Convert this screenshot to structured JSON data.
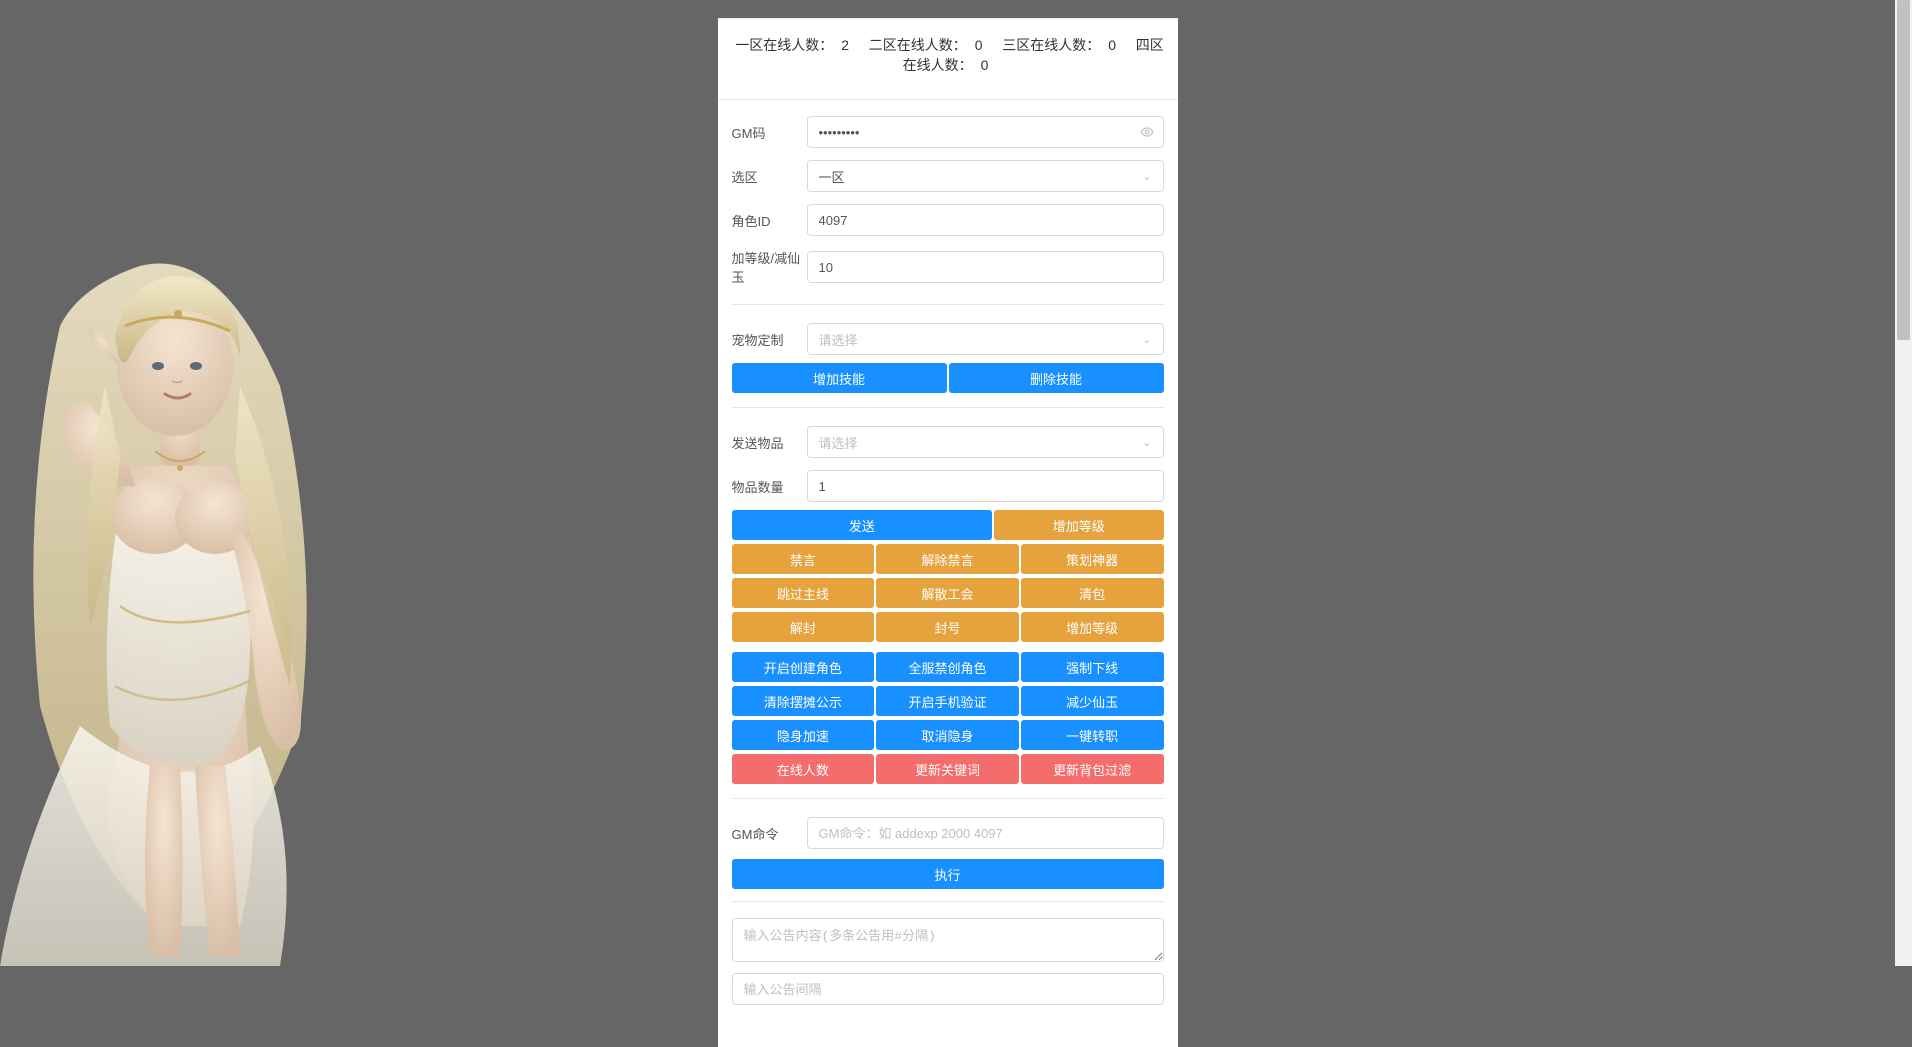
{
  "header": {
    "zone1_label": "一区在线人数：",
    "zone1_count": "2",
    "zone2_label": "二区在线人数：",
    "zone2_count": "0",
    "zone3_label": "三区在线人数：",
    "zone3_count": "0",
    "zone4_label": "四区在线人数：",
    "zone4_count": "0"
  },
  "form": {
    "gm_code_label": "GM码",
    "gm_code_value": "•••••••••",
    "zone_label": "选区",
    "zone_value": "一区",
    "role_id_label": "角色ID",
    "role_id_value": "4097",
    "level_label": "加等级/减仙玉",
    "level_value": "10",
    "pet_label": "宠物定制",
    "pet_placeholder": "请选择",
    "send_item_label": "发送物品",
    "send_item_placeholder": "请选择",
    "item_qty_label": "物品数量",
    "item_qty_value": "1",
    "gm_cmd_label": "GM命令",
    "gm_cmd_placeholder": "GM命令：如 addexp 2000 4097",
    "announce_placeholder": "输入公告内容(多条公告用#分隔)",
    "announce_interval_placeholder": "输入公告间隔"
  },
  "buttons": {
    "add_skill": "增加技能",
    "del_skill": "删除技能",
    "send": "发送",
    "add_level": "增加等级",
    "mute": "禁言",
    "unmute": "解除禁言",
    "plan_weapon": "策划神器",
    "skip_main": "跳过主线",
    "disband_guild": "解散工会",
    "clear_bag": "清包",
    "unban": "解封",
    "ban": "封号",
    "add_level2": "增加等级",
    "open_create": "开启创建角色",
    "server_forbid": "全服禁创角色",
    "force_offline": "强制下线",
    "clear_vote": "清除摆摊公示",
    "open_phone": "开启手机验证",
    "reduce_xianyu": "减少仙玉",
    "stealth_speed": "隐身加速",
    "cancel_stealth": "取消隐身",
    "one_key_transfer": "一键转职",
    "online_count": "在线人数",
    "update_keyword": "更新关键词",
    "update_bag_filter": "更新背包过滤",
    "execute": "执行"
  }
}
